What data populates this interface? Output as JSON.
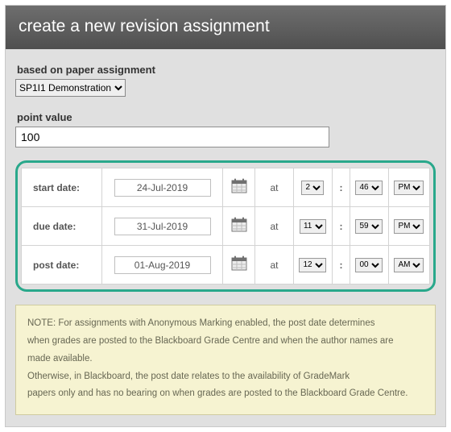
{
  "header": {
    "title": "create a new revision assignment"
  },
  "based_on": {
    "label": "based on paper assignment",
    "selected": "SP1I1 Demonstration"
  },
  "point_value": {
    "label": "point value",
    "value": "100"
  },
  "dates": {
    "rows": [
      {
        "label": "start date:",
        "date": "24-Jul-2019",
        "hour": "2",
        "minute": "46",
        "ampm": "PM"
      },
      {
        "label": "due date:",
        "date": "31-Jul-2019",
        "hour": "11",
        "minute": "59",
        "ampm": "PM"
      },
      {
        "label": "post date:",
        "date": "01-Aug-2019",
        "hour": "12",
        "minute": "00",
        "ampm": "AM"
      }
    ],
    "at_label": "at",
    "colon": ":"
  },
  "note": {
    "line1": "NOTE: For assignments with Anonymous Marking enabled, the post date determines",
    "line2": "when grades are posted to the Blackboard Grade Centre and when the author names are",
    "line3": "made available.",
    "line4": "Otherwise, in Blackboard, the post date relates to the availability of GradeMark",
    "line5": "papers only and has no bearing on when grades are posted to the Blackboard Grade Centre."
  }
}
